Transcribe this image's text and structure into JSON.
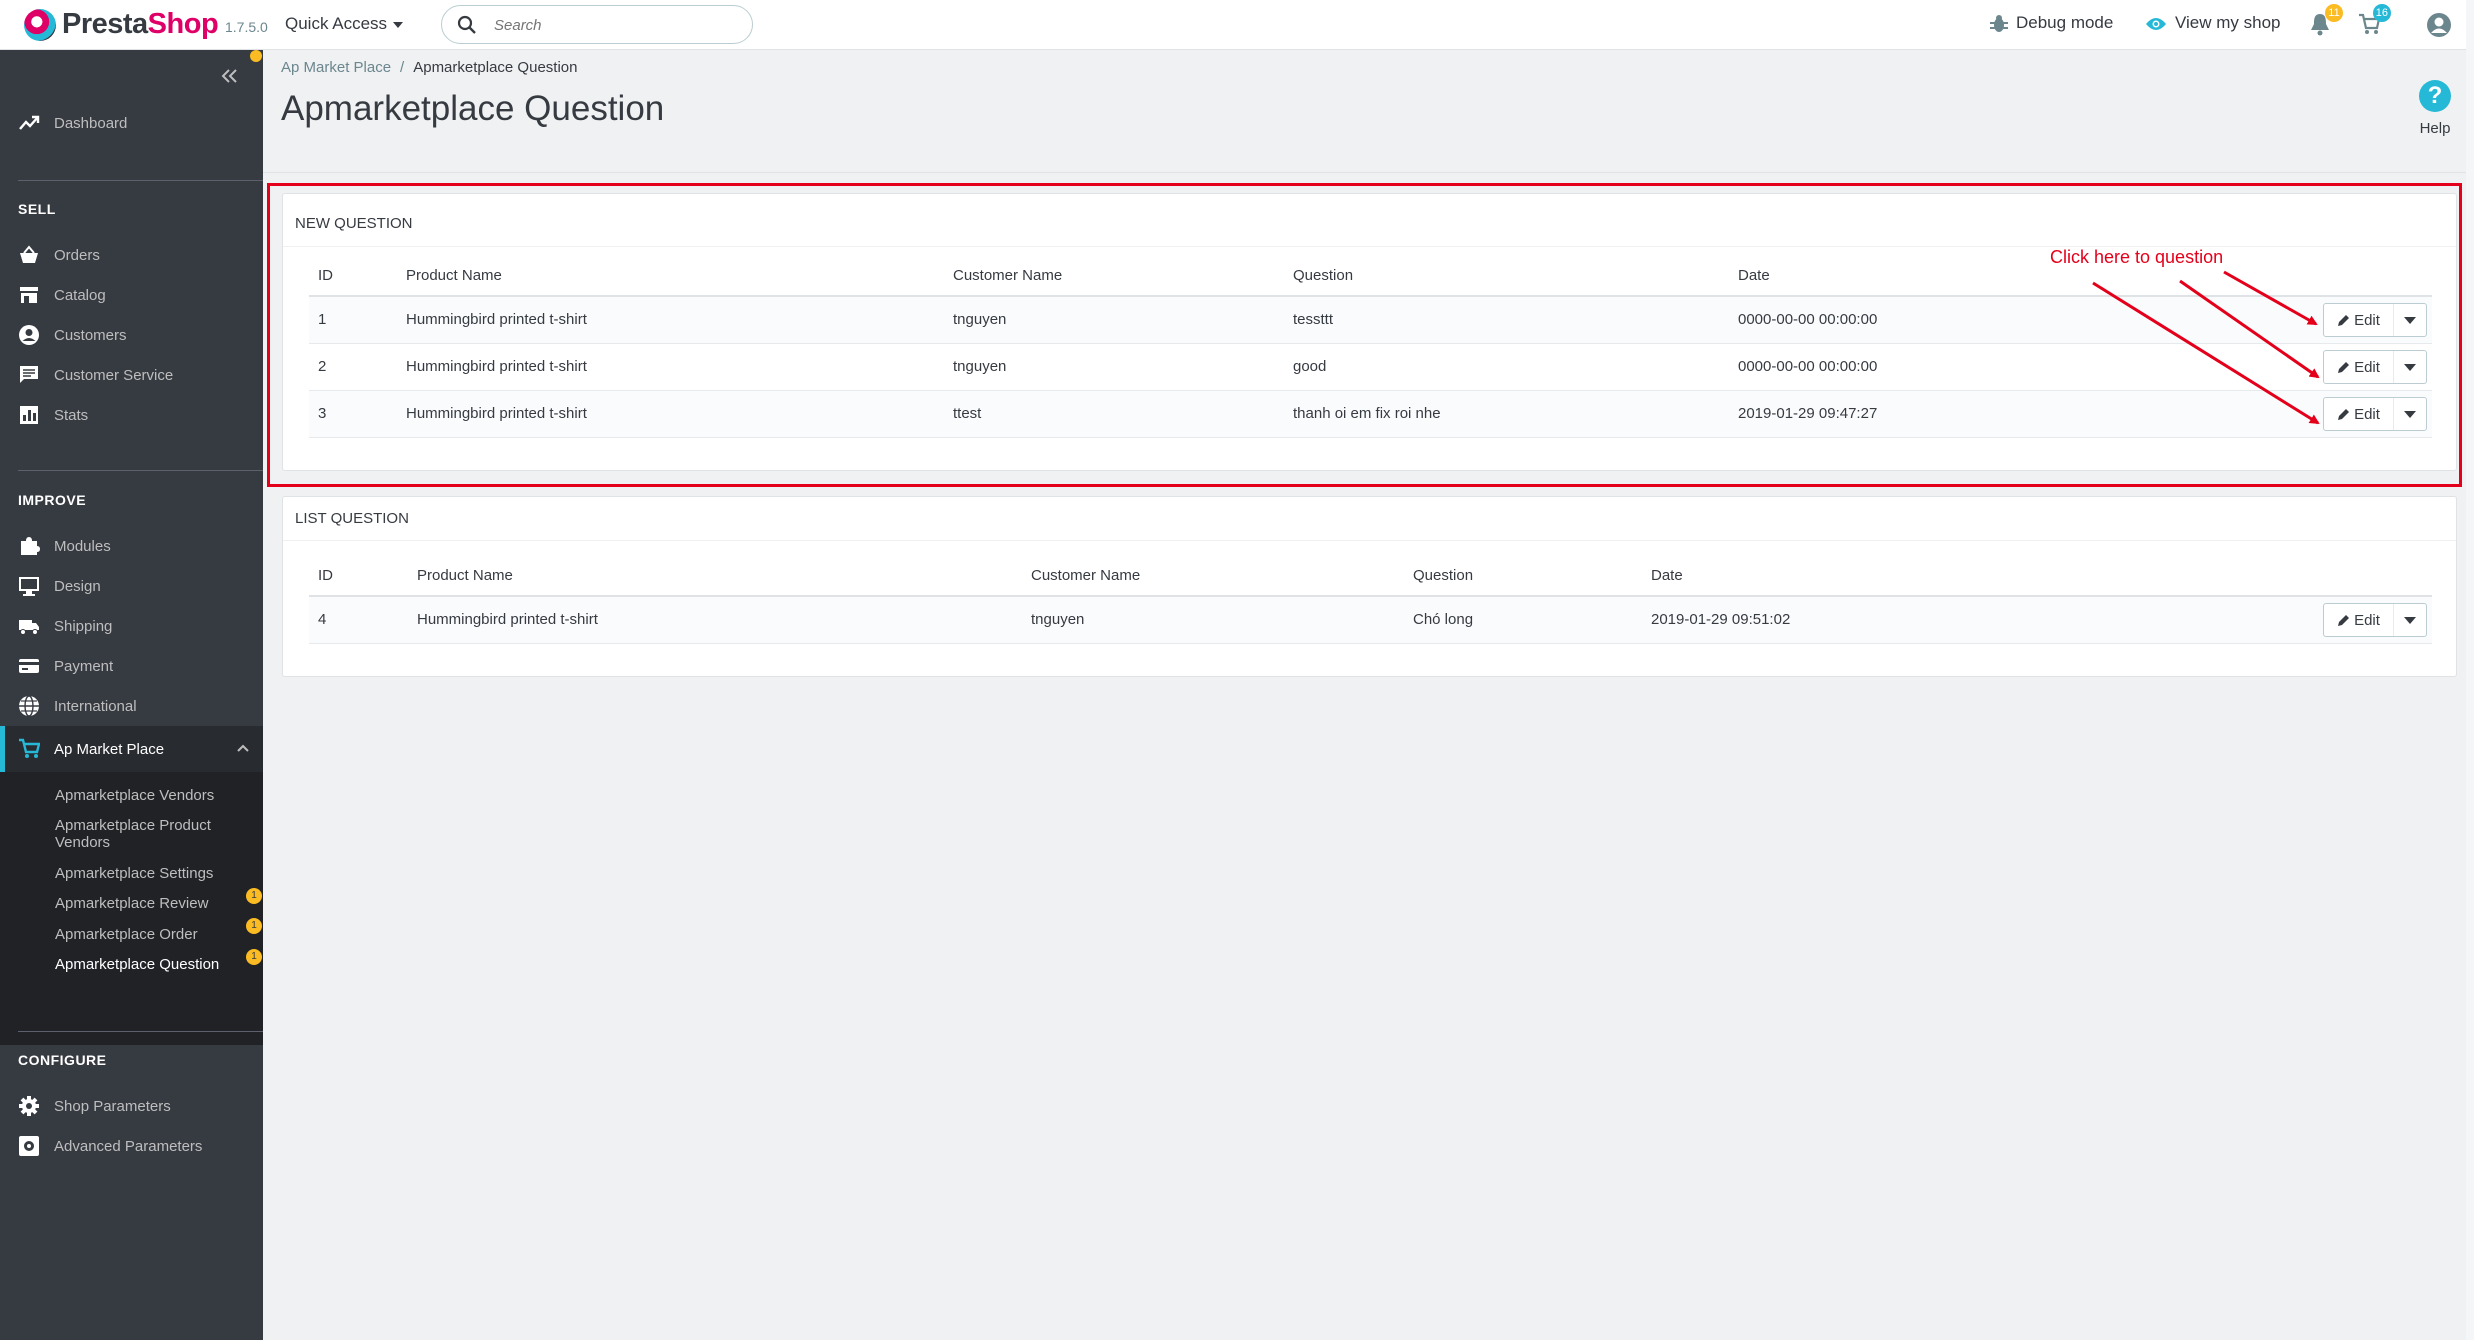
{
  "header": {
    "brand_presta": "Presta",
    "brand_shop": "Shop",
    "version": "1.7.5.0",
    "quick_access": "Quick Access",
    "search_placeholder": "Search",
    "debug_mode": "Debug mode",
    "view_shop": "View my shop",
    "notif_orders": "11",
    "notif_customers": "16",
    "accent": "#25b9d7",
    "brand_color": "#df0067"
  },
  "sidebar": {
    "dashboard": "Dashboard",
    "sell_title": "SELL",
    "sell_items": [
      "Orders",
      "Catalog",
      "Customers",
      "Customer Service",
      "Stats"
    ],
    "improve_title": "IMPROVE",
    "improve_items": [
      "Modules",
      "Design",
      "Shipping",
      "Payment",
      "International",
      "Ap Market Place"
    ],
    "sub_items": [
      "Apmarketplace Vendors",
      "Apmarketplace Product Vendors",
      "Apmarketplace Settings",
      "Apmarketplace Review",
      "Apmarketplace Order",
      "Apmarketplace Question"
    ],
    "sub_badges": [
      "1",
      "1",
      "1"
    ],
    "configure_title": "CONFIGURE",
    "configure_items": [
      "Shop Parameters",
      "Advanced Parameters"
    ]
  },
  "breadcrumb": {
    "parent": "Ap Market Place",
    "separator": "/",
    "current": "Apmarketplace Question"
  },
  "page_title": "Apmarketplace Question",
  "help_label": "Help",
  "new_question": {
    "title": "NEW QUESTION",
    "columns": [
      "ID",
      "Product Name",
      "Customer Name",
      "Question",
      "Date"
    ],
    "rows": [
      {
        "id": "1",
        "product": "Hummingbird printed t-shirt",
        "customer": "tnguyen",
        "question": "tessttt",
        "date": "0000-00-00 00:00:00",
        "action": "Edit"
      },
      {
        "id": "2",
        "product": "Hummingbird printed t-shirt",
        "customer": "tnguyen",
        "question": "good",
        "date": "0000-00-00 00:00:00",
        "action": "Edit"
      },
      {
        "id": "3",
        "product": "Hummingbird printed t-shirt",
        "customer": "ttest",
        "question": "thanh oi em fix roi nhe",
        "date": "2019-01-29 09:47:27",
        "action": "Edit"
      }
    ]
  },
  "list_question": {
    "title": "LIST QUESTION",
    "columns": [
      "ID",
      "Product Name",
      "Customer Name",
      "Question",
      "Date"
    ],
    "rows": [
      {
        "id": "4",
        "product": "Hummingbird printed t-shirt",
        "customer": "tnguyen",
        "question": "Chó long",
        "date": "2019-01-29 09:51:02",
        "action": "Edit"
      }
    ]
  },
  "annotation": "Click here to question",
  "annotation_color": "#e4001b"
}
